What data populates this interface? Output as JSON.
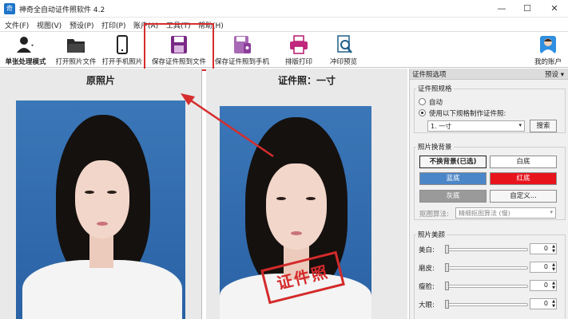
{
  "window": {
    "title": "神奇全自动证件照软件 4.2",
    "app_icon": "app-icon"
  },
  "menu": [
    "文件(F)",
    "视图(V)",
    "预设(P)",
    "打印(P)",
    "账户(A)",
    "工具(T)",
    "帮助(H)"
  ],
  "toolbar": {
    "single_mode": "单张处理模式",
    "open_photo": "打开照片文件",
    "open_phone": "打开手机照片",
    "save_file": "保存证件照到文件",
    "save_phone": "保存证件照到手机",
    "layout_print": "排版打印",
    "print_preview": "冲印预览",
    "my_account": "我的账户"
  },
  "panels": {
    "original_title": "原照片",
    "id_title": "证件照：一寸",
    "stamp_text": "证件照"
  },
  "options": {
    "header": "证件照选项",
    "preset": "预设",
    "spec_group": "证件照规格",
    "auto": "自动",
    "use_spec": "使用以下规格制作证件照:",
    "spec_value": "1. 一寸",
    "search": "搜索",
    "bg_group": "照片换背景",
    "no_change_bg": "不换背景(已选)",
    "white_bg": "白底",
    "blue_bg": "蓝底",
    "red_bg": "红底",
    "gray_bg": "灰底",
    "custom": "自定义...",
    "algo_label": "抠图算法:",
    "algo_value": "精细抠图算法 (慢)",
    "beauty_group": "照片美颜",
    "sliders": [
      {
        "label": "美白:",
        "value": "0"
      },
      {
        "label": "磨皮:",
        "value": "0"
      },
      {
        "label": "瘦脸:",
        "value": "0"
      },
      {
        "label": "大眼:",
        "value": "0"
      }
    ]
  },
  "colors": {
    "highlight": "#d62d2d",
    "photo_bg": "#2f6aad",
    "blue_btn": "#4a86c8",
    "red_btn": "#e8141c",
    "gray_btn": "#9a9a9a"
  }
}
